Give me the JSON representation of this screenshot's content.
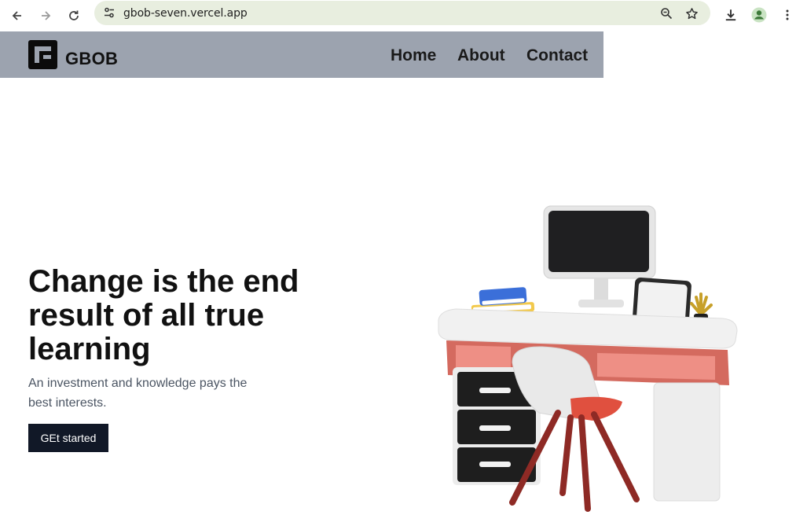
{
  "browser": {
    "url": "gbob-seven.vercel.app",
    "icons": {
      "back": "arrow-left-icon",
      "forward": "arrow-right-icon",
      "reload": "reload-icon",
      "site_info": "tune-icon",
      "zoom": "zoom-icon",
      "bookmark": "star-icon",
      "download": "download-icon",
      "profile": "profile-icon",
      "menu": "kebab-menu-icon"
    }
  },
  "header": {
    "logo_text": "GBOB",
    "nav": [
      "Home",
      "About",
      "Contact"
    ]
  },
  "hero": {
    "title": "Change is the end result of all true learning",
    "subtitle": "An investment and knowledge pays the best interests.",
    "cta_label": "GEt started"
  },
  "colors": {
    "header_bg": "#9ca3af",
    "cta_bg": "#111827",
    "omnibox_bg": "#e8eedf"
  }
}
